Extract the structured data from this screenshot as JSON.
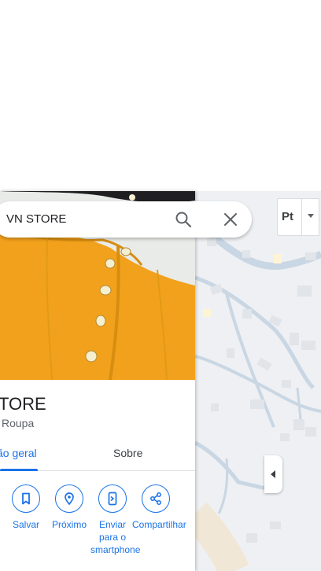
{
  "search": {
    "query": "VN STORE"
  },
  "place": {
    "name": "TORE",
    "category": "Roupa"
  },
  "tabs": [
    {
      "label": "ão geral"
    },
    {
      "label": "Sobre"
    }
  ],
  "actions": [
    {
      "label": "Salvar",
      "icon": "bookmark-icon"
    },
    {
      "label": "Próximo",
      "icon": "nearby-icon"
    },
    {
      "label": "Enviar para o smartphone",
      "icon": "send-to-phone-icon"
    },
    {
      "label": "Compartilhar",
      "icon": "share-icon"
    }
  ],
  "map_controls": {
    "layers_label": "Pt"
  },
  "colors": {
    "accent": "#1a73e8",
    "photo_main": "#f2a11c",
    "map_bg": "#eef0f3",
    "road": "#c9d6e3"
  }
}
